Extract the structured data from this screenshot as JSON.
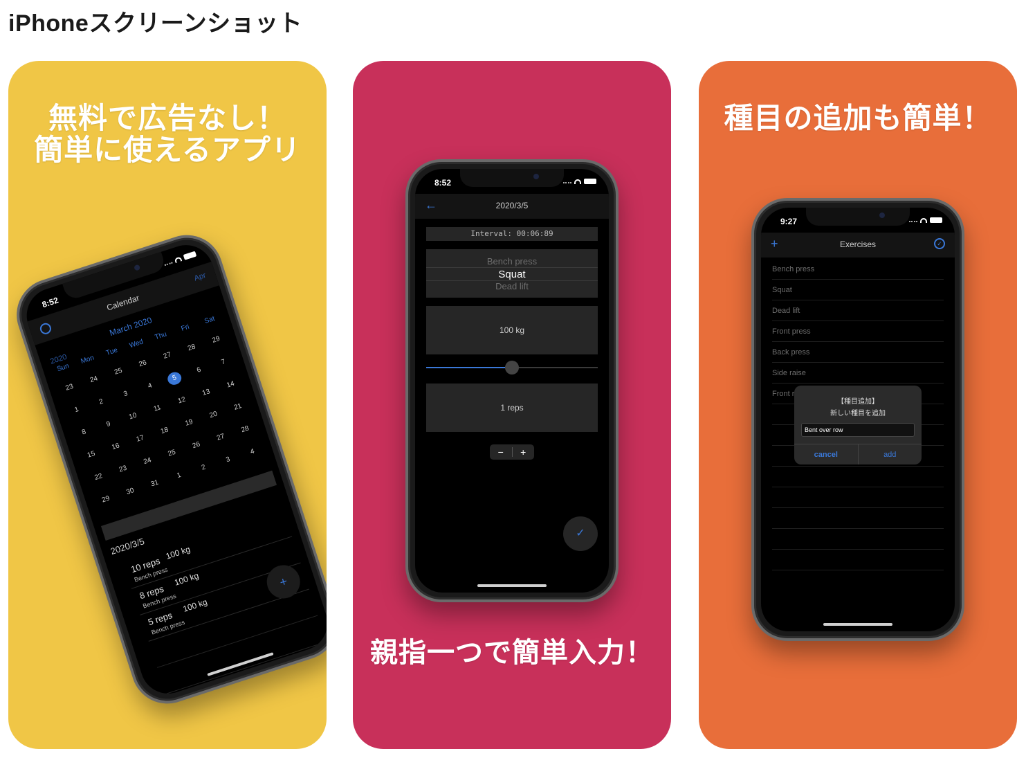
{
  "page": {
    "title": "iPhoneスクリーンショット"
  },
  "cards": [
    {
      "headline_lines": [
        "無料で広告なし！",
        "簡単に使えるアプリ"
      ],
      "screen": {
        "time": "8:52",
        "nav_title": "Calendar",
        "nav_right": "Apr",
        "prev_month": "2020",
        "month_title": "March 2020",
        "weekdays": [
          "Sun",
          "Mon",
          "Tue",
          "Wed",
          "Thu",
          "Fri",
          "Sat"
        ],
        "days": [
          "23",
          "24",
          "25",
          "26",
          "27",
          "28",
          "29",
          "1",
          "2",
          "3",
          "4",
          "5",
          "6",
          "7",
          "8",
          "9",
          "10",
          "11",
          "12",
          "13",
          "14",
          "15",
          "16",
          "17",
          "18",
          "19",
          "20",
          "21",
          "22",
          "23",
          "24",
          "25",
          "26",
          "27",
          "28",
          "29",
          "30",
          "31",
          "1",
          "2",
          "3",
          "4"
        ],
        "selected_day": "5",
        "selected_date": "2020/3/5",
        "logs": [
          {
            "reps": "10 reps",
            "weight": "100 kg",
            "exercise": "Bench press"
          },
          {
            "reps": "8 reps",
            "weight": "100 kg",
            "exercise": "Bench press"
          },
          {
            "reps": "5 reps",
            "weight": "100 kg",
            "exercise": "Bench press"
          }
        ],
        "fab_icon": "+"
      }
    },
    {
      "headline": "親指一つで簡単入力！",
      "screen": {
        "time": "8:52",
        "nav_title": "2020/3/5",
        "interval": "Interval: 00:06:89",
        "picker": {
          "above": "Bench press",
          "selected": "Squat",
          "below": "Dead lift"
        },
        "weight": "100 kg",
        "slider_fraction": 0.5,
        "reps": "1 reps",
        "stepper": {
          "minus": "−",
          "plus": "+"
        },
        "fab_icon": "✓"
      }
    },
    {
      "headline": "種目の追加も簡単！",
      "screen": {
        "time": "9:27",
        "nav_title": "Exercises",
        "exercises": [
          "Bench press",
          "Squat",
          "Dead lift",
          "Front press",
          "Back press",
          "Side raise",
          "Front ra..."
        ],
        "dialog": {
          "title": "【種目追加】",
          "message": "新しい種目を追加",
          "input_value": "Bent over row",
          "cancel_label": "cancel",
          "add_label": "add"
        }
      }
    }
  ],
  "colors": {
    "card1": "#f0c646",
    "card2": "#c8305a",
    "card3": "#e86e3a",
    "accent": "#3a78d8"
  }
}
